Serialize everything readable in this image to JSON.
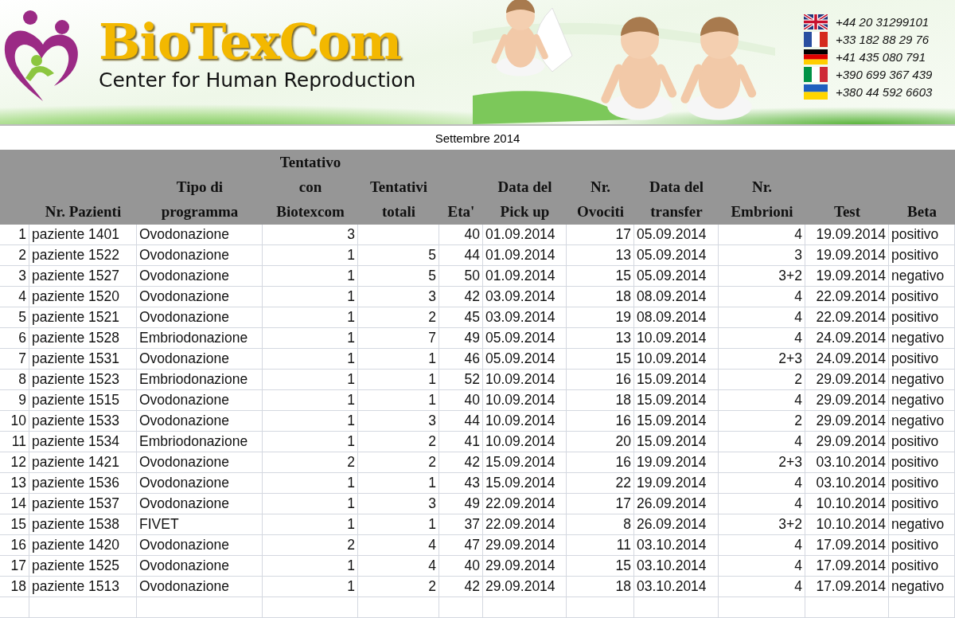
{
  "banner": {
    "brand": "BioTexCom",
    "tagline": "Center for Human Reproduction",
    "phones": [
      {
        "kind": "uk",
        "number": "+44 20 31299101"
      },
      {
        "kind": "fr",
        "number": "+33 182 88 29 76"
      },
      {
        "kind": "de",
        "number": "+41 435 080 791"
      },
      {
        "kind": "it",
        "number": "+390 699 367 439"
      },
      {
        "kind": "ua",
        "number": "+380 44 592 6603"
      }
    ]
  },
  "sheet_title": "Settembre 2014",
  "table": {
    "columns": [
      {
        "label": "Nr. Pazienti",
        "kind": "text"
      },
      {
        "label": "Tipo di\nprogramma",
        "kind": "text"
      },
      {
        "label": "Tentativo\ncon\nBiotexcom",
        "kind": "number"
      },
      {
        "label": "Tentativi\ntotali",
        "kind": "number"
      },
      {
        "label": "Eta'",
        "kind": "number"
      },
      {
        "label": "Data del\nPick up",
        "kind": "text"
      },
      {
        "label": "Nr.\nOvociti",
        "kind": "number"
      },
      {
        "label": "Data del\ntransfer",
        "kind": "text"
      },
      {
        "label": "Nr.\nEmbrioni",
        "kind": "number"
      },
      {
        "label": "Test",
        "kind": "number"
      },
      {
        "label": "Beta",
        "kind": "text"
      }
    ],
    "rows": [
      {
        "number": "1",
        "cells": [
          "paziente 1401",
          "Ovodonazione",
          "3",
          null,
          "40",
          "01.09.2014",
          "17",
          "05.09.2014",
          "4",
          "19.09.2014",
          "positivo"
        ]
      },
      {
        "number": "2",
        "cells": [
          "paziente 1522",
          "Ovodonazione",
          "1",
          "5",
          "44",
          "01.09.2014",
          "13",
          "05.09.2014",
          "3",
          "19.09.2014",
          "positivo"
        ]
      },
      {
        "number": "3",
        "cells": [
          "paziente 1527",
          "Ovodonazione",
          "1",
          "5",
          "50",
          "01.09.2014",
          "15",
          "05.09.2014",
          "3+2",
          "19.09.2014",
          "negativo"
        ]
      },
      {
        "number": "4",
        "cells": [
          "paziente 1520",
          "Ovodonazione",
          "1",
          "3",
          "42",
          "03.09.2014",
          "18",
          "08.09.2014",
          "4",
          "22.09.2014",
          "positivo"
        ]
      },
      {
        "number": "5",
        "cells": [
          "paziente 1521",
          "Ovodonazione",
          "1",
          "2",
          "45",
          "03.09.2014",
          "19",
          "08.09.2014",
          "4",
          "22.09.2014",
          "positivo"
        ]
      },
      {
        "number": "6",
        "cells": [
          "paziente 1528",
          "Embriodonazione",
          "1",
          "7",
          "49",
          "05.09.2014",
          "13",
          "10.09.2014",
          "4",
          "24.09.2014",
          "negativo"
        ]
      },
      {
        "number": "7",
        "cells": [
          "paziente 1531",
          "Ovodonazione",
          "1",
          "1",
          "46",
          "05.09.2014",
          "15",
          "10.09.2014",
          "2+3",
          "24.09.2014",
          "positivo"
        ]
      },
      {
        "number": "8",
        "cells": [
          "paziente 1523",
          "Embriodonazione",
          "1",
          "1",
          "52",
          "10.09.2014",
          "16",
          "15.09.2014",
          "2",
          "29.09.2014",
          "negativo"
        ]
      },
      {
        "number": "9",
        "cells": [
          "paziente 1515",
          "Ovodonazione",
          "1",
          "1",
          "40",
          "10.09.2014",
          "18",
          "15.09.2014",
          "4",
          "29.09.2014",
          "negativo"
        ]
      },
      {
        "number": "10",
        "cells": [
          "paziente 1533",
          "Ovodonazione",
          "1",
          "3",
          "44",
          "10.09.2014",
          "16",
          "15.09.2014",
          "2",
          "29.09.2014",
          "negativo"
        ]
      },
      {
        "number": "11",
        "cells": [
          "paziente 1534",
          "Embriodonazione",
          "1",
          "2",
          "41",
          "10.09.2014",
          "20",
          "15.09.2014",
          "4",
          "29.09.2014",
          "positivo"
        ]
      },
      {
        "number": "12",
        "cells": [
          "paziente 1421",
          "Ovodonazione",
          "2",
          "2",
          "42",
          "15.09.2014",
          "16",
          "19.09.2014",
          "2+3",
          "03.10.2014",
          "positivo"
        ]
      },
      {
        "number": "13",
        "cells": [
          "paziente 1536",
          "Ovodonazione",
          "1",
          "1",
          "43",
          "15.09.2014",
          "22",
          "19.09.2014",
          "4",
          "03.10.2014",
          "positivo"
        ]
      },
      {
        "number": "14",
        "cells": [
          "paziente 1537",
          "Ovodonazione",
          "1",
          "3",
          "49",
          "22.09.2014",
          "17",
          "26.09.2014",
          "4",
          "10.10.2014",
          "positivo"
        ]
      },
      {
        "number": "15",
        "cells": [
          "paziente 1538",
          "FIVET",
          "1",
          "1",
          "37",
          "22.09.2014",
          "8",
          "26.09.2014",
          "3+2",
          "10.10.2014",
          "negativo"
        ]
      },
      {
        "number": "16",
        "cells": [
          "paziente 1420",
          "Ovodonazione",
          "2",
          "4",
          "47",
          "29.09.2014",
          "11",
          "03.10.2014",
          "4",
          "17.09.2014",
          "positivo"
        ]
      },
      {
        "number": "17",
        "cells": [
          "paziente 1525",
          "Ovodonazione",
          "1",
          "4",
          "40",
          "29.09.2014",
          "15",
          "03.10.2014",
          "4",
          "17.09.2014",
          "positivo"
        ]
      },
      {
        "number": "18",
        "cells": [
          "paziente 1513",
          "Ovodonazione",
          "1",
          "2",
          "42",
          "29.09.2014",
          "18",
          "03.10.2014",
          "4",
          "17.09.2014",
          "negativo"
        ]
      }
    ]
  }
}
